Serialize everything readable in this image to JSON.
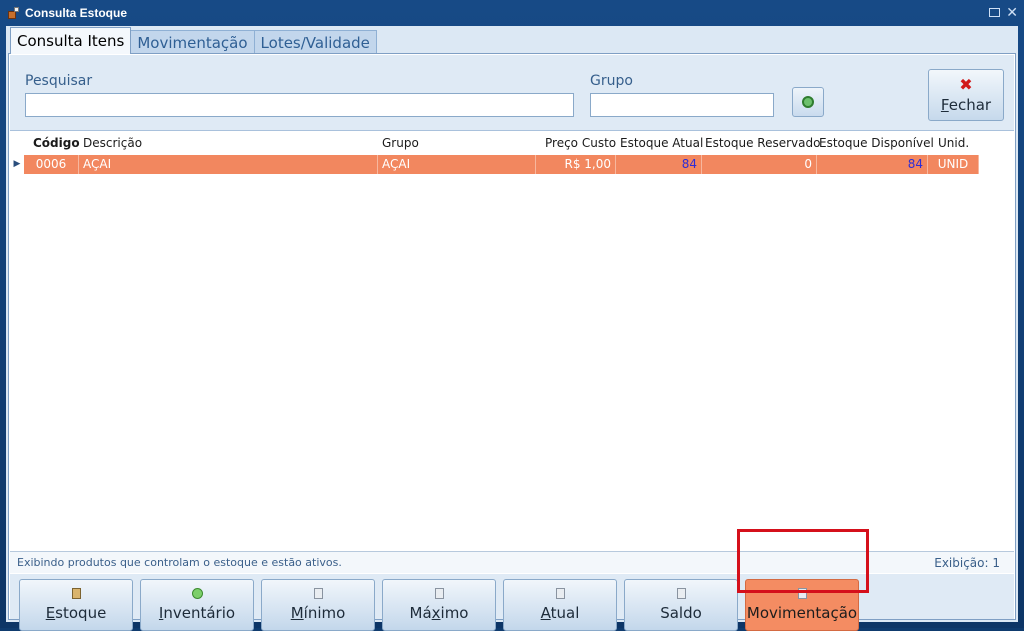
{
  "window": {
    "title": "Consulta Estoque"
  },
  "tabs": [
    {
      "label": "Consulta Itens",
      "active": true
    },
    {
      "label": "Movimentação",
      "active": false
    },
    {
      "label": "Lotes/Validade",
      "active": false
    }
  ],
  "search": {
    "pesquisar_label": "Pesquisar",
    "pesquisar_value": "",
    "grupo_label": "Grupo",
    "grupo_value": "",
    "fechar_label_accel": "F",
    "fechar_label_rest": "echar"
  },
  "grid": {
    "columns": [
      "Código",
      "Descrição",
      "Grupo",
      "Preço Custo",
      "Estoque Atual",
      "Estoque Reservado",
      "Estoque Disponível",
      "Unid."
    ],
    "rows": [
      {
        "codigo": "0006",
        "descricao": "AÇAI",
        "grupo": "AÇAI",
        "preco_custo": "R$ 1,00",
        "estoque_atual": "84",
        "estoque_reservado": "0",
        "estoque_disponivel": "84",
        "unid": "UNID"
      }
    ],
    "selection_color": "#f2875f"
  },
  "status": {
    "message": "Exibindo produtos que controlam o estoque e estão ativos.",
    "exibicao": "Exibição: 1"
  },
  "buttons": {
    "estoque": {
      "accel": "E",
      "rest": "stoque",
      "icon": "clipboard-icon"
    },
    "inventario": {
      "accel": "I",
      "rest": "nventário",
      "icon": "add-circle-icon"
    },
    "minimo": {
      "accel": "M",
      "rest": "ínimo",
      "icon": "document-icon"
    },
    "maximo_pre": "Má",
    "maximo_accel": "x",
    "maximo_post": "imo",
    "atual": {
      "accel": "A",
      "rest": "tual",
      "icon": "document-icon"
    },
    "saldo": {
      "label": "Saldo",
      "icon": "document-icon"
    },
    "movimentacao": {
      "label": "Movimentação",
      "icon": "document-icon",
      "highlight": "#d5101b"
    }
  }
}
